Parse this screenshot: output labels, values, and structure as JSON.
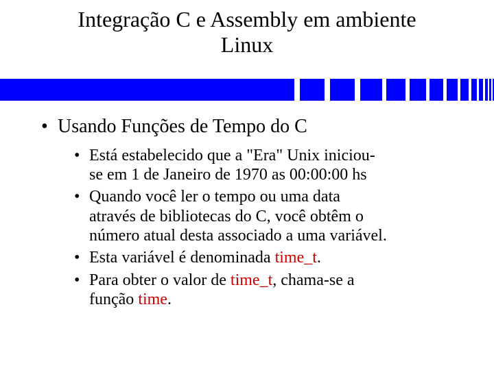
{
  "title_line1": "Integração C e Assembly em ambiente",
  "title_line2": "Linux",
  "heading": "Usando Funções de Tempo do C",
  "b1a": "Está estabelecido que a \"Era\" Unix iniciou-",
  "b1b": "se em 1 de Janeiro de 1970 as 00:00:00 hs",
  "b2a": "Quando você ler o tempo ou uma data",
  "b2b": "através de bibliotecas do C, você obtêm o",
  "b2c": "número atual desta associado a uma variável.",
  "b3_prefix": "Esta variável é denominada ",
  "b3_hl": "time_t",
  "b3_suffix": ".",
  "b4_prefix": "Para obter o valor de ",
  "b4_hl1": "time_t",
  "b4_mid": ", chama-se a",
  "b4_line2_prefix": "função ",
  "b4_hl2": "time",
  "b4_suffix": "."
}
